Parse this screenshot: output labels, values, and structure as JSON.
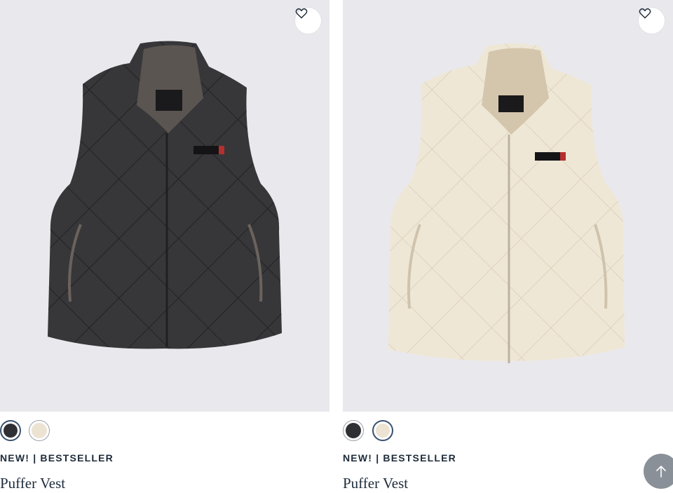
{
  "products": [
    {
      "badge": "NEW! | BESTSELLER",
      "name": "Puffer Vest",
      "image_alt": "Black puffer vest",
      "color": "#37373a",
      "swatches": [
        {
          "name": "black",
          "color": "#2f3033",
          "selected": true
        },
        {
          "name": "cream",
          "color": "#ece3d2",
          "selected": false
        }
      ]
    },
    {
      "badge": "NEW! | BESTSELLER",
      "name": "Puffer Vest",
      "image_alt": "Cream puffer vest",
      "color": "#efe7d6",
      "swatches": [
        {
          "name": "black",
          "color": "#2f3033",
          "selected": false
        },
        {
          "name": "cream",
          "color": "#ece3d2",
          "selected": true
        }
      ]
    }
  ],
  "icons": {
    "wishlist": "heart-icon",
    "back_to_top": "arrow-up-icon"
  },
  "colors": {
    "image_bg": "#e9e8ec",
    "text": "#1e2b3a",
    "swatch_selected_ring": "#39506e",
    "back_to_top_bg": "#8a9097"
  }
}
